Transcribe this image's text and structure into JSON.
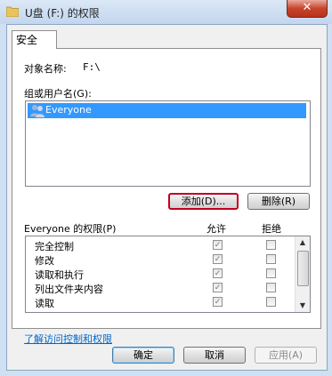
{
  "window": {
    "title": "U盘 (F:) 的权限",
    "close_glyph": "✕"
  },
  "tab": {
    "label": "安全"
  },
  "object": {
    "label": "对象名称:",
    "value": "F:\\"
  },
  "groups": {
    "label": "组或用户名(G):",
    "items": [
      "Everyone"
    ]
  },
  "buttons": {
    "add": "添加(D)...",
    "remove": "删除(R)",
    "ok": "确定",
    "cancel": "取消",
    "apply": "应用(A)"
  },
  "permissions": {
    "header": "Everyone 的权限(P)",
    "allow_header": "允许",
    "deny_header": "拒绝",
    "rows": [
      {
        "name": "完全控制",
        "allow": true,
        "deny": false
      },
      {
        "name": "修改",
        "allow": true,
        "deny": false
      },
      {
        "name": "读取和执行",
        "allow": true,
        "deny": false
      },
      {
        "name": "列出文件夹内容",
        "allow": true,
        "deny": false
      },
      {
        "name": "读取",
        "allow": true,
        "deny": false
      }
    ]
  },
  "link": {
    "text": "了解访问控制和权限"
  },
  "icons": {
    "folder": "folder-icon",
    "users": "users-icon",
    "close": "close-icon",
    "check": "✓"
  },
  "colors": {
    "selection": "#3399ff",
    "add_highlight": "#c0001e",
    "link": "#0066cc"
  }
}
